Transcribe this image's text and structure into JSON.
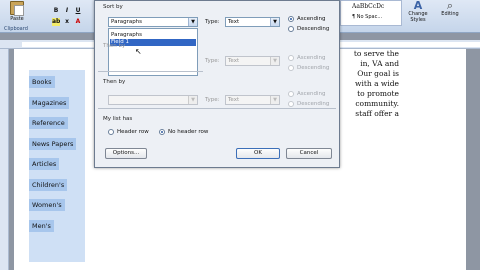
{
  "ribbon": {
    "paste_label": "Paste",
    "clipboard_label": "Clipboard",
    "font_buttons": [
      "B",
      "I",
      "U",
      "ab",
      "x",
      "A"
    ],
    "style_sample": "AaBbCcDc",
    "style_name": "¶ No Spac...",
    "change_styles": "Change Styles",
    "editing": "Editing"
  },
  "document": {
    "list_items": [
      "Books",
      "Magazines",
      "Reference",
      "News Papers",
      "Articles",
      "Children's",
      "Women's",
      "Men's"
    ],
    "text_lines": [
      "to serve the",
      "in, VA and",
      "Our goal is",
      "with a wide",
      "to promote",
      "community.",
      "staff offer a"
    ]
  },
  "dialog": {
    "sort_by_label": "Sort by",
    "sort_by_value": "Paragraphs",
    "type_label": "Type:",
    "type_value": "Text",
    "ascending": "Ascending",
    "descending": "Descending",
    "open_options": [
      "Paragraphs",
      "Field 1"
    ],
    "then_by_label_1": "Then by",
    "then_by_label_2": "Then by",
    "list_has_label": "My list has",
    "header_row": "Header row",
    "no_header_row": "No header row",
    "options_button": "Options...",
    "ok_button": "OK",
    "cancel_button": "Cancel"
  }
}
